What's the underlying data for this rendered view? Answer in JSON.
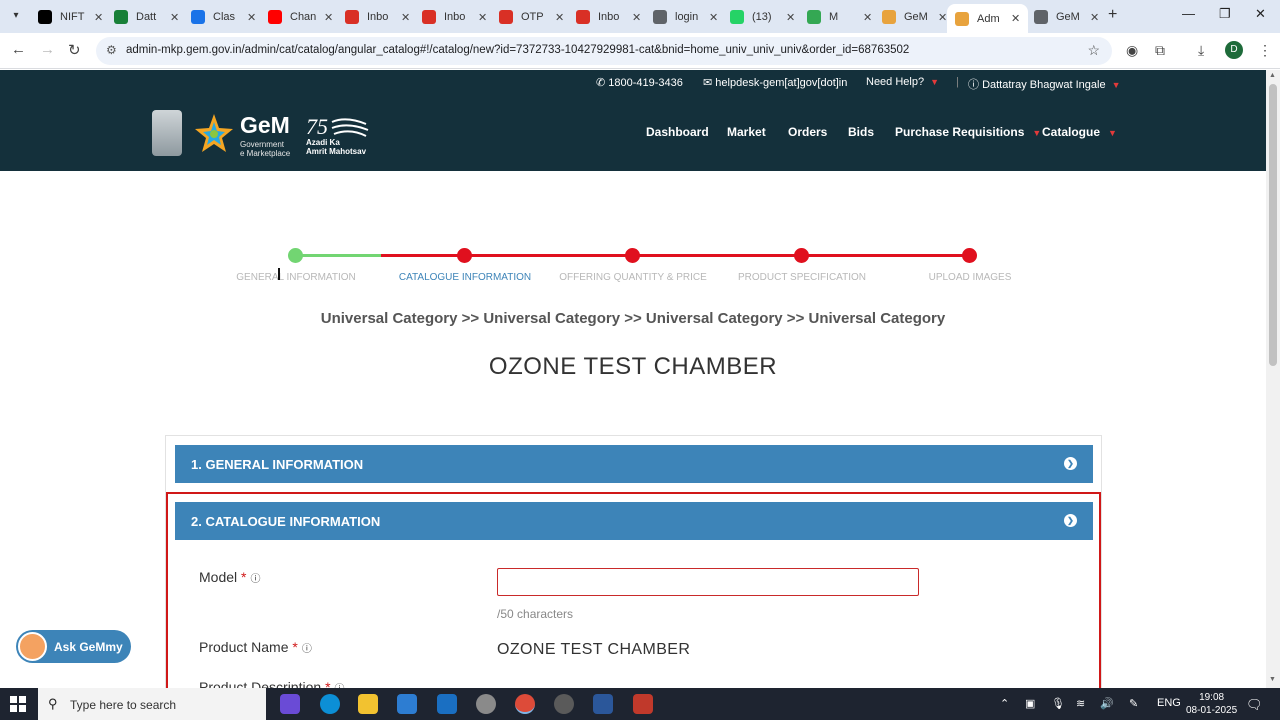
{
  "browser": {
    "tabs": [
      {
        "title": "NIFT",
        "color": "#000000"
      },
      {
        "title": "Datt",
        "color": "#188038"
      },
      {
        "title": "Clas",
        "color": "#1a73e8"
      },
      {
        "title": "Chan",
        "color": "#ff0000"
      },
      {
        "title": "Inbo",
        "color": "#d93025"
      },
      {
        "title": "Inbo",
        "color": "#d93025"
      },
      {
        "title": "OTP",
        "color": "#d93025"
      },
      {
        "title": "Inbo",
        "color": "#d93025"
      },
      {
        "title": "login",
        "color": "#5f6368"
      },
      {
        "title": "(13)",
        "color": "#25d366"
      },
      {
        "title": "M",
        "color": "#34a853"
      },
      {
        "title": "GeM",
        "color": "#e8a33d"
      },
      {
        "title": "Adm",
        "color": "#e8a33d"
      },
      {
        "title": "GeM",
        "color": "#5f6368"
      }
    ],
    "active_tab_index": 12,
    "url": "admin-mkp.gem.gov.in/admin/cat/catalog/angular_catalog#!/catalog/new?id=7372733-10427929981-cat&bnid=home_univ_univ_univ&order_id=68763502",
    "profile_initial": "D"
  },
  "header": {
    "phone": "1800-419-3436",
    "email": "helpdesk-gem[at]gov[dot]in",
    "need_help": "Need Help?",
    "user": "Dattatray Bhagwat Ingale",
    "logo_text": "GeM",
    "logo_sub_1": "Government",
    "logo_sub_2": "e Marketplace",
    "azadi_1": "Azadi Ka",
    "azadi_2": "Amrit Mahotsav",
    "nav": [
      "Dashboard",
      "Market",
      "Orders",
      "Bids",
      "Purchase Requisitions",
      "Catalogue"
    ]
  },
  "stepper": {
    "steps": [
      "GENERAL INFORMATION",
      "CATALOGUE INFORMATION",
      "OFFERING QUANTITY & PRICE",
      "PRODUCT SPECIFICATION",
      "UPLOAD IMAGES"
    ],
    "current": 1,
    "done_color": "#72d572",
    "pending_color": "#e0101e"
  },
  "breadcrumb": "Universal Category >> Universal Category >> Universal Category >> Universal Category",
  "product_title": "OZONE TEST CHAMBER",
  "sections": {
    "general": "1. GENERAL INFORMATION",
    "catalogue": "2. CATALOGUE INFORMATION"
  },
  "form": {
    "model_label": "Model",
    "model_value": "",
    "char_count": "/50 characters",
    "product_name_label": "Product Name",
    "product_name_value": "OZONE TEST CHAMBER",
    "product_desc_label": "Product Description"
  },
  "chatbot": "Ask GeMmy",
  "taskbar": {
    "search_placeholder": "Type here to search",
    "lang": "ENG",
    "time": "19:08",
    "date": "08-01-2025"
  }
}
